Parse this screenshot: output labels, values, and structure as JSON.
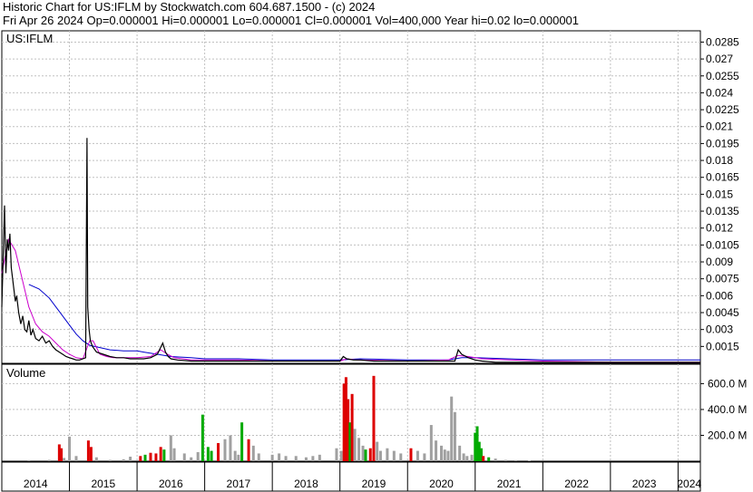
{
  "header": {
    "line1": "Historic Chart for US:IFLM by Stockwatch.com 604.687.1500 - (c) 2024",
    "line2": "Fri Apr 26 2024   Op=0.000001   Hi=0.000001   Lo=0.000001   Cl=0.000001   Vol=400,000   Year hi=0.02   lo=0.000001"
  },
  "symbol_label": "US:IFLM",
  "volume_label": "Volume",
  "colors": {
    "price": "#000000",
    "ma_short": "#cc00cc",
    "ma_long": "#0000cc",
    "vol_up": "#00aa00",
    "vol_down": "#dd0000",
    "vol_flat": "#a0a0a0",
    "grid": "#c0c0c0"
  },
  "chart_data": [
    {
      "type": "line",
      "name": "price",
      "ylim": [
        0,
        0.0295
      ],
      "xlim": [
        2014,
        2024.33
      ],
      "yticks": [
        "0.0285",
        "0.027",
        "0.0255",
        "0.024",
        "0.0225",
        "0.021",
        "0.0195",
        "0.018",
        "0.0165",
        "0.015",
        "0.0135",
        "0.012",
        "0.0105",
        "0.009",
        "0.0075",
        "0.006",
        "0.0045",
        "0.003",
        "0.0015"
      ],
      "x_labels": [
        "2014",
        "2015",
        "2016",
        "2017",
        "2018",
        "2019",
        "2020",
        "2021",
        "2022",
        "2023",
        "2024"
      ],
      "series": [
        {
          "key": "price",
          "x": [
            2014.0,
            2014.02,
            2014.04,
            2014.06,
            2014.08,
            2014.1,
            2014.12,
            2014.14,
            2014.16,
            2014.18,
            2014.2,
            2014.22,
            2014.25,
            2014.28,
            2014.31,
            2014.34,
            2014.37,
            2014.4,
            2014.43,
            2014.46,
            2014.5,
            2014.55,
            2014.6,
            2014.65,
            2014.7,
            2014.75,
            2014.8,
            2014.85,
            2014.9,
            2014.95,
            2015.0,
            2015.05,
            2015.1,
            2015.15,
            2015.2,
            2015.24,
            2015.26,
            2015.27,
            2015.29,
            2015.31,
            2015.34,
            2015.4,
            2015.5,
            2015.6,
            2015.7,
            2015.8,
            2015.9,
            2016.0,
            2016.1,
            2016.2,
            2016.3,
            2016.38,
            2016.42,
            2016.46,
            2016.5,
            2016.6,
            2016.8,
            2017.0,
            2017.5,
            2018.0,
            2018.5,
            2019.0,
            2019.05,
            2019.1,
            2019.2,
            2019.3,
            2019.5,
            2019.8,
            2020.0,
            2020.3,
            2020.5,
            2020.6,
            2020.7,
            2020.75,
            2020.8,
            2020.9,
            2021.0,
            2021.1,
            2021.3,
            2021.6,
            2022.0,
            2022.5,
            2023.0,
            2023.5,
            2024.0,
            2024.33
          ],
          "y": [
            0.005,
            0.0095,
            0.014,
            0.008,
            0.011,
            0.01,
            0.0115,
            0.0085,
            0.0075,
            0.0065,
            0.0055,
            0.006,
            0.0045,
            0.0035,
            0.0042,
            0.003,
            0.0028,
            0.0038,
            0.0025,
            0.003,
            0.0022,
            0.002,
            0.0024,
            0.0018,
            0.002,
            0.0015,
            0.0012,
            0.001,
            0.0008,
            0.0006,
            0.0005,
            0.0004,
            0.0003,
            0.0003,
            0.0004,
            0.0005,
            0.02,
            0.005,
            0.003,
            0.002,
            0.0015,
            0.001,
            0.0008,
            0.0006,
            0.0005,
            0.0005,
            0.0004,
            0.0004,
            0.0004,
            0.0005,
            0.0008,
            0.0018,
            0.001,
            0.0006,
            0.0004,
            0.0003,
            0.0002,
            0.0002,
            0.0002,
            0.0002,
            0.0002,
            0.0002,
            0.0006,
            0.0004,
            0.0003,
            0.0003,
            0.0002,
            0.0002,
            0.0002,
            0.0002,
            0.0002,
            0.0002,
            0.0002,
            0.0012,
            0.0008,
            0.0005,
            0.0003,
            0.0002,
            0.0001,
            0.0001,
            0.0001,
            0.0001,
            0.0001,
            0.0001,
            0.0001,
            0.0001
          ]
        },
        {
          "key": "ma_short",
          "x": [
            2014.0,
            2014.1,
            2014.2,
            2014.3,
            2014.4,
            2014.5,
            2014.6,
            2014.7,
            2014.8,
            2014.9,
            2015.0,
            2015.1,
            2015.2,
            2015.3,
            2015.35,
            2015.45,
            2015.55,
            2015.65,
            2015.8,
            2016.0,
            2016.2,
            2016.35,
            2016.45,
            2016.55,
            2016.8,
            2017.0,
            2017.5,
            2018.0,
            2019.0,
            2019.1,
            2019.25,
            2020.0,
            2020.6,
            2020.75,
            2020.9,
            2021.1,
            2021.5,
            2022.0,
            2023.0,
            2024.0,
            2024.33
          ],
          "y": [
            0.008,
            0.011,
            0.01,
            0.0075,
            0.005,
            0.0035,
            0.0028,
            0.0024,
            0.0018,
            0.0012,
            0.0008,
            0.0005,
            0.0004,
            0.002,
            0.002,
            0.0008,
            0.0006,
            0.0005,
            0.0005,
            0.0005,
            0.0006,
            0.0012,
            0.0008,
            0.0005,
            0.0003,
            0.0003,
            0.0003,
            0.0002,
            0.0002,
            0.0004,
            0.0003,
            0.0002,
            0.0003,
            0.0007,
            0.0006,
            0.0004,
            0.0003,
            0.0002,
            0.0001,
            0.0001,
            0.0001
          ]
        },
        {
          "key": "ma_long",
          "x": [
            2014.4,
            2014.55,
            2014.7,
            2014.85,
            2015.0,
            2015.1,
            2015.2,
            2015.3,
            2015.45,
            2015.6,
            2015.8,
            2016.0,
            2016.1,
            2016.3,
            2016.5,
            2016.8,
            2017.0,
            2017.5,
            2018.0,
            2019.0,
            2019.3,
            2020.0,
            2020.6,
            2020.8,
            2021.0,
            2021.5,
            2022.0,
            2023.0,
            2024.0,
            2024.33
          ],
          "y": [
            0.007,
            0.0066,
            0.0058,
            0.0046,
            0.0034,
            0.0026,
            0.002,
            0.0016,
            0.0014,
            0.0012,
            0.0011,
            0.0011,
            0.001,
            0.0008,
            0.0006,
            0.0005,
            0.0004,
            0.0004,
            0.0003,
            0.0003,
            0.0004,
            0.0003,
            0.0003,
            0.0005,
            0.0005,
            0.0004,
            0.0003,
            0.0003,
            0.0003,
            0.0003
          ]
        }
      ]
    },
    {
      "type": "bar",
      "name": "volume",
      "ylim": [
        0,
        750
      ],
      "yticks": [
        "600.0 M",
        "400.0 M",
        "200.0 M"
      ],
      "bars": [
        {
          "x": 2014.4,
          "v": 8,
          "c": "vol_flat"
        },
        {
          "x": 2014.7,
          "v": 10,
          "c": "vol_flat"
        },
        {
          "x": 2014.85,
          "v": 130,
          "c": "vol_down"
        },
        {
          "x": 2014.88,
          "v": 100,
          "c": "vol_down"
        },
        {
          "x": 2014.92,
          "v": 25,
          "c": "vol_flat"
        },
        {
          "x": 2015.0,
          "v": 190,
          "c": "vol_flat"
        },
        {
          "x": 2015.1,
          "v": 40,
          "c": "vol_flat"
        },
        {
          "x": 2015.28,
          "v": 160,
          "c": "vol_down"
        },
        {
          "x": 2015.32,
          "v": 110,
          "c": "vol_down"
        },
        {
          "x": 2015.4,
          "v": 30,
          "c": "vol_flat"
        },
        {
          "x": 2015.6,
          "v": 10,
          "c": "vol_flat"
        },
        {
          "x": 2015.8,
          "v": 15,
          "c": "vol_flat"
        },
        {
          "x": 2015.9,
          "v": 35,
          "c": "vol_flat"
        },
        {
          "x": 2016.05,
          "v": 40,
          "c": "vol_down"
        },
        {
          "x": 2016.12,
          "v": 50,
          "c": "vol_up"
        },
        {
          "x": 2016.2,
          "v": 65,
          "c": "vol_down"
        },
        {
          "x": 2016.28,
          "v": 60,
          "c": "vol_down"
        },
        {
          "x": 2016.35,
          "v": 110,
          "c": "vol_down"
        },
        {
          "x": 2016.4,
          "v": 90,
          "c": "vol_up"
        },
        {
          "x": 2016.5,
          "v": 200,
          "c": "vol_flat"
        },
        {
          "x": 2016.55,
          "v": 100,
          "c": "vol_flat"
        },
        {
          "x": 2016.7,
          "v": 60,
          "c": "vol_flat"
        },
        {
          "x": 2016.8,
          "v": 30,
          "c": "vol_flat"
        },
        {
          "x": 2016.9,
          "v": 70,
          "c": "vol_flat"
        },
        {
          "x": 2016.97,
          "v": 360,
          "c": "vol_up"
        },
        {
          "x": 2017.05,
          "v": 110,
          "c": "vol_up"
        },
        {
          "x": 2017.1,
          "v": 80,
          "c": "vol_up"
        },
        {
          "x": 2017.2,
          "v": 140,
          "c": "vol_down"
        },
        {
          "x": 2017.3,
          "v": 170,
          "c": "vol_flat"
        },
        {
          "x": 2017.38,
          "v": 200,
          "c": "vol_flat"
        },
        {
          "x": 2017.45,
          "v": 80,
          "c": "vol_flat"
        },
        {
          "x": 2017.5,
          "v": 50,
          "c": "vol_flat"
        },
        {
          "x": 2017.55,
          "v": 300,
          "c": "vol_up"
        },
        {
          "x": 2017.65,
          "v": 170,
          "c": "vol_down"
        },
        {
          "x": 2017.72,
          "v": 120,
          "c": "vol_flat"
        },
        {
          "x": 2017.8,
          "v": 60,
          "c": "vol_flat"
        },
        {
          "x": 2018.0,
          "v": 50,
          "c": "vol_flat"
        },
        {
          "x": 2018.1,
          "v": 60,
          "c": "vol_flat"
        },
        {
          "x": 2018.2,
          "v": 40,
          "c": "vol_flat"
        },
        {
          "x": 2018.35,
          "v": 40,
          "c": "vol_flat"
        },
        {
          "x": 2018.5,
          "v": 30,
          "c": "vol_flat"
        },
        {
          "x": 2018.6,
          "v": 40,
          "c": "vol_flat"
        },
        {
          "x": 2018.7,
          "v": 50,
          "c": "vol_flat"
        },
        {
          "x": 2018.95,
          "v": 100,
          "c": "vol_flat"
        },
        {
          "x": 2019.02,
          "v": 80,
          "c": "vol_flat"
        },
        {
          "x": 2019.06,
          "v": 600,
          "c": "vol_down"
        },
        {
          "x": 2019.09,
          "v": 650,
          "c": "vol_down"
        },
        {
          "x": 2019.12,
          "v": 480,
          "c": "vol_down"
        },
        {
          "x": 2019.15,
          "v": 300,
          "c": "vol_up"
        },
        {
          "x": 2019.18,
          "v": 520,
          "c": "vol_down"
        },
        {
          "x": 2019.22,
          "v": 250,
          "c": "vol_flat"
        },
        {
          "x": 2019.28,
          "v": 180,
          "c": "vol_flat"
        },
        {
          "x": 2019.34,
          "v": 120,
          "c": "vol_flat"
        },
        {
          "x": 2019.38,
          "v": 90,
          "c": "vol_up"
        },
        {
          "x": 2019.45,
          "v": 100,
          "c": "vol_down"
        },
        {
          "x": 2019.5,
          "v": 660,
          "c": "vol_down"
        },
        {
          "x": 2019.55,
          "v": 150,
          "c": "vol_flat"
        },
        {
          "x": 2019.6,
          "v": 80,
          "c": "vol_flat"
        },
        {
          "x": 2019.7,
          "v": 100,
          "c": "vol_flat"
        },
        {
          "x": 2019.8,
          "v": 80,
          "c": "vol_flat"
        },
        {
          "x": 2019.9,
          "v": 60,
          "c": "vol_flat"
        },
        {
          "x": 2020.05,
          "v": 100,
          "c": "vol_down"
        },
        {
          "x": 2020.15,
          "v": 80,
          "c": "vol_flat"
        },
        {
          "x": 2020.25,
          "v": 60,
          "c": "vol_flat"
        },
        {
          "x": 2020.35,
          "v": 280,
          "c": "vol_flat"
        },
        {
          "x": 2020.42,
          "v": 160,
          "c": "vol_flat"
        },
        {
          "x": 2020.5,
          "v": 120,
          "c": "vol_flat"
        },
        {
          "x": 2020.55,
          "v": 90,
          "c": "vol_flat"
        },
        {
          "x": 2020.6,
          "v": 80,
          "c": "vol_flat"
        },
        {
          "x": 2020.65,
          "v": 500,
          "c": "vol_flat"
        },
        {
          "x": 2020.7,
          "v": 380,
          "c": "vol_flat"
        },
        {
          "x": 2020.77,
          "v": 120,
          "c": "vol_flat"
        },
        {
          "x": 2020.83,
          "v": 60,
          "c": "vol_flat"
        },
        {
          "x": 2020.88,
          "v": 40,
          "c": "vol_flat"
        },
        {
          "x": 2020.95,
          "v": 50,
          "c": "vol_flat"
        },
        {
          "x": 2021.0,
          "v": 220,
          "c": "vol_up"
        },
        {
          "x": 2021.03,
          "v": 270,
          "c": "vol_up"
        },
        {
          "x": 2021.06,
          "v": 150,
          "c": "vol_up"
        },
        {
          "x": 2021.09,
          "v": 100,
          "c": "vol_up"
        },
        {
          "x": 2021.12,
          "v": 40,
          "c": "vol_down"
        },
        {
          "x": 2021.2,
          "v": 30,
          "c": "vol_up"
        },
        {
          "x": 2021.3,
          "v": 20,
          "c": "vol_flat"
        },
        {
          "x": 2021.45,
          "v": 10,
          "c": "vol_flat"
        },
        {
          "x": 2021.6,
          "v": 8,
          "c": "vol_flat"
        },
        {
          "x": 2021.8,
          "v": 5,
          "c": "vol_flat"
        }
      ]
    }
  ]
}
